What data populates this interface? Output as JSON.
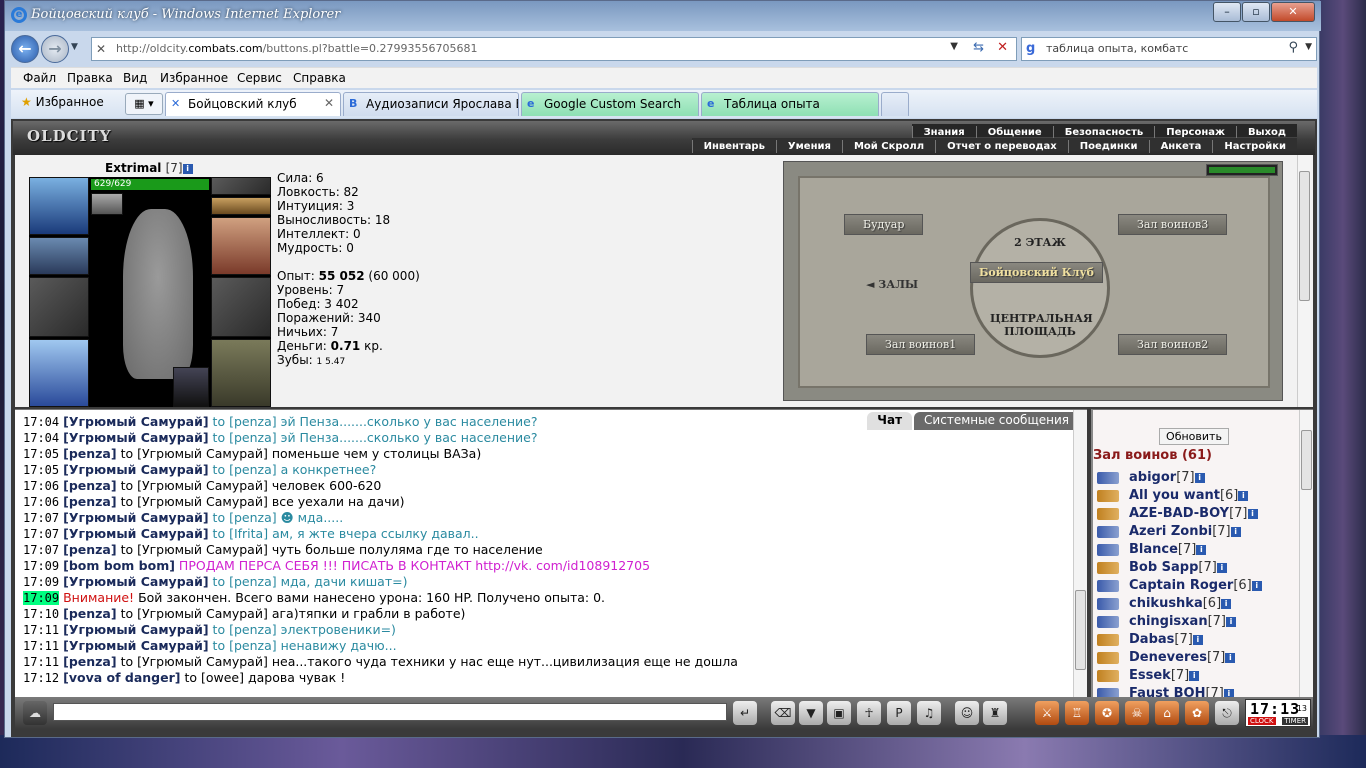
{
  "window": {
    "title": "Бойцовский клуб - Windows Internet Explorer"
  },
  "nav": {
    "url_prefix": "http://oldcity.",
    "url_domain": "combats.com",
    "url_rest": "/buttons.pl?battle=0.27993556705681",
    "search_value": "таблица опыта, комбатс"
  },
  "menu": [
    "Файл",
    "Правка",
    "Вид",
    "Избранное",
    "Сервис",
    "Справка"
  ],
  "favorites_label": "Избранное",
  "tabs": [
    {
      "label": "Бойцовский клуб",
      "active": true
    },
    {
      "label": "Аудиозаписи Ярослава Б...",
      "active": false
    },
    {
      "label": "Google Custom Search",
      "active": false
    },
    {
      "label": "Таблица опыта",
      "active": false
    }
  ],
  "game": {
    "logo": "OLDCITY",
    "top_menu": [
      "Знания",
      "Общение",
      "Безопасность",
      "Персонаж",
      "Выход"
    ],
    "sub_menu": [
      "Инвентарь",
      "Умения",
      "Мой Скролл",
      "Отчет о переводах",
      "Поединки",
      "Анкета",
      "Настройки"
    ]
  },
  "character": {
    "nick": "Extrimal",
    "level": "[7]",
    "hp": "629/629",
    "stats": [
      "Сила: 6",
      "Ловкость: 82",
      "Интуиция: 3",
      "Выносливость: 18",
      "Интеллект: 0",
      "Мудрость: 0"
    ],
    "exp_label": "Опыт:",
    "exp_value": "55 052",
    "exp_next": "(60 000)",
    "level_line": "Уровень: 7",
    "wins": "Побед: 3 402",
    "losses": "Поражений: 340",
    "draws": "Ничьих: 7",
    "money_label": "Деньги:",
    "money_value": "0.71",
    "money_unit": "кр.",
    "teeth_label": "Зубы:",
    "teeth_value": "1 5.47"
  },
  "map": {
    "floor": "2 ЭТАЖ",
    "boudoir": "Будуар",
    "hall3": "Зал воинов3",
    "club": "Бойцовский Клуб",
    "halls": "ЗАЛЫ",
    "square": "ЦЕНТРАЛЬНАЯ ПЛОЩАДЬ",
    "hall1": "Зал воинов1",
    "hall2": "Зал воинов2"
  },
  "chat": {
    "tabs": [
      "Чат",
      "Системные сообщения"
    ],
    "lines": [
      {
        "t": "17:04",
        "n": "Угрюмый Самурай",
        "to": "[penza]",
        "m": "эй Пенза.......сколько у вас население?",
        "style": "teal"
      },
      {
        "t": "17:04",
        "n": "Угрюмый Самурай",
        "to": "[penza]",
        "m": "эй Пенза.......сколько у вас население?",
        "style": "teal"
      },
      {
        "t": "17:05",
        "n": "penza",
        "to": "[Угрюмый Самурай]",
        "m": "поменьше чем у столицы ВАЗа)",
        "style": ""
      },
      {
        "t": "17:05",
        "n": "Угрюмый Самурай",
        "to": "[penza]",
        "m": "а конкретнее?",
        "style": "teal"
      },
      {
        "t": "17:06",
        "n": "penza",
        "to": "[Угрюмый Самурай]",
        "m": "человек 600-620",
        "style": ""
      },
      {
        "t": "17:06",
        "n": "penza",
        "to": "[Угрюмый Самурай]",
        "m": "все уехали на дачи)",
        "style": ""
      },
      {
        "t": "17:07",
        "n": "Угрюмый Самурай",
        "to": "[penza]",
        "m": "☻ мда.....",
        "style": "teal"
      },
      {
        "t": "17:07",
        "n": "Угрюмый Самурай",
        "to": "[Ifrita]",
        "m": "ам, я жте вчера ссылку давал..",
        "style": "teal"
      },
      {
        "t": "17:07",
        "n": "penza",
        "to": "[Угрюмый Самурай]",
        "m": "чуть больше полуляма где то население",
        "style": ""
      },
      {
        "t": "17:09",
        "n": "bom bom bom",
        "to": "",
        "m": "ПРОДАМ ПЕРСА СЕБЯ !!! ПИСАТЬ В КОНТАКТ http://vk. com/id108912705",
        "style": "pink"
      },
      {
        "t": "17:09",
        "n": "Угрюмый Самурай",
        "to": "[penza]",
        "m": "мда, дачи кишат=)",
        "style": "teal"
      },
      {
        "t": "17:09",
        "n": "",
        "to": "",
        "m": "Бой закончен. Всего вами нанесено урона: 160 HP. Получено опыта: 0.",
        "style": "sys",
        "warn": "Внимание!"
      },
      {
        "t": "17:10",
        "n": "penza",
        "to": "[Угрюмый Самурай]",
        "m": "ага)тяпки и грабли в работе)",
        "style": ""
      },
      {
        "t": "17:11",
        "n": "Угрюмый Самурай",
        "to": "[penza]",
        "m": "электровеники=)",
        "style": "teal"
      },
      {
        "t": "17:11",
        "n": "Угрюмый Самурай",
        "to": "[penza]",
        "m": "ненавижу дачю...",
        "style": "teal"
      },
      {
        "t": "17:11",
        "n": "penza",
        "to": "[Угрюмый Самурай]",
        "m": "неа...такого чуда техники у нас еще нут...цивилизация еще не дошла",
        "style": ""
      },
      {
        "t": "17:12",
        "n": "vova of danger",
        "to": "[owee]",
        "m": "дарова чувак !",
        "style": ""
      }
    ]
  },
  "users": {
    "refresh": "Обновить",
    "room": "Зал воинов (61)",
    "list": [
      {
        "name": "abigor",
        "lv": "[7]",
        "c": "b"
      },
      {
        "name": "All you want",
        "lv": "[6]",
        "c": "o"
      },
      {
        "name": "AZE-BAD-BOY",
        "lv": "[7]",
        "c": "o"
      },
      {
        "name": "Azeri Zonbi",
        "lv": "[7]",
        "c": "b"
      },
      {
        "name": "Blance",
        "lv": "[7]",
        "c": "b"
      },
      {
        "name": "Bob Sapp",
        "lv": "[7]",
        "c": "o"
      },
      {
        "name": "Captain Roger",
        "lv": "[6]",
        "c": "b"
      },
      {
        "name": "chikushka",
        "lv": "[6]",
        "c": "b"
      },
      {
        "name": "chingisxan",
        "lv": "[7]",
        "c": "b"
      },
      {
        "name": "Dabas",
        "lv": "[7]",
        "c": "o"
      },
      {
        "name": "Deneveres",
        "lv": "[7]",
        "c": "o"
      },
      {
        "name": "Essek",
        "lv": "[7]",
        "c": "o"
      },
      {
        "name": "Faust BOH",
        "lv": "[7]",
        "c": "b"
      }
    ]
  },
  "clock": {
    "time": "17:13",
    "sec": "13",
    "clock_label": "CLOCK",
    "timer_label": "TIMER"
  }
}
